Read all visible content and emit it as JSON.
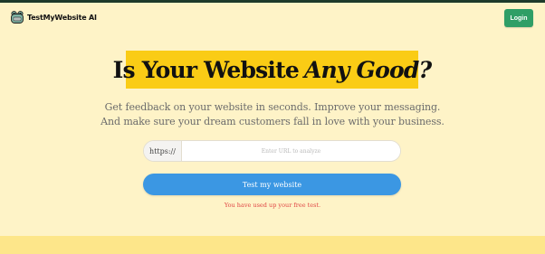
{
  "header": {
    "logo_text": "TestMyWebsite AI",
    "logo_icon": "robot-frog-icon",
    "login_label": "Login"
  },
  "hero": {
    "headline_main": "Is Your Website",
    "headline_emphasis": "Any Good?",
    "subtitle_line1": "Get feedback on your website in seconds. Improve your messaging.",
    "subtitle_line2": "And make sure your dream customers fall in love with your business."
  },
  "form": {
    "url_prefix": "https://",
    "url_placeholder": "Enter URL to analyze",
    "url_value": "",
    "submit_label": "Test my website",
    "error_message": "You have used up your free test."
  },
  "colors": {
    "background": "#fef3c7",
    "headline_highlight": "#facc15",
    "login_button": "#2f9e66",
    "primary_button": "#3b97e3",
    "error_text": "#e04545",
    "bottom_band": "#fde68a"
  }
}
